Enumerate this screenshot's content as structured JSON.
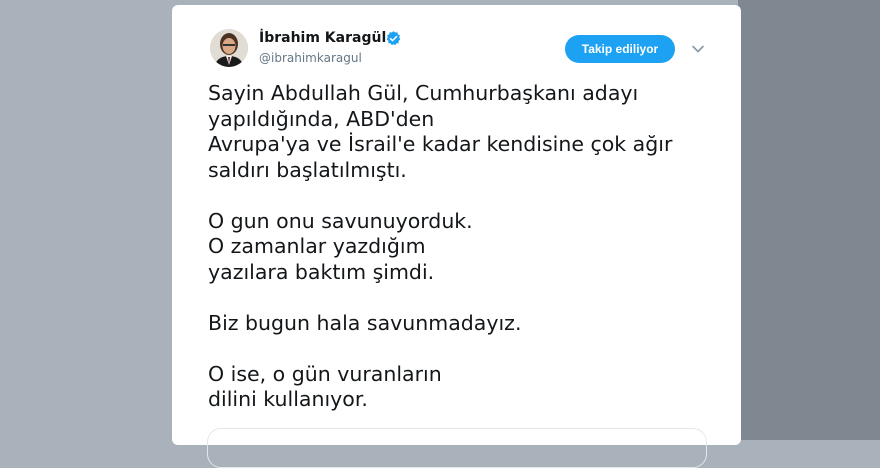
{
  "tweet": {
    "author": {
      "display_name": "İbrahim Karagül",
      "handle": "@ibrahimkaragul",
      "verified_icon": "verified-badge-icon",
      "avatar_icon": "profile-photo"
    },
    "follow_button_label": "Takip ediliyor",
    "menu_icon": "chevron-down-icon",
    "text": "Sayin Abdullah Gül, Cumhurbaşkanı adayı\nyapıldığında, ABD'den\nAvrupa'ya ve İsrail'e kadar kendisine çok ağır\nsaldırı başlatılmıştı.\n\nO gun onu savunuyorduk.\nO zamanlar yazdığım\nyazılara baktım şimdi.\n\nBiz bugun hala savunmadayız.\n\nO ise, o gün vuranların\ndilini kullanıyor."
  },
  "colors": {
    "accent": "#1da1f2",
    "text": "#14171a",
    "secondary_text": "#657786",
    "background": "#a9b2bb"
  }
}
